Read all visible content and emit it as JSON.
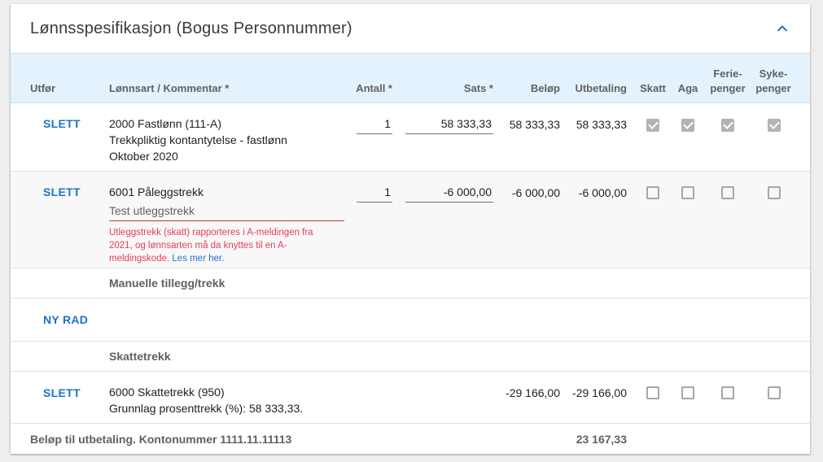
{
  "title": "Lønnsspesifikasjon (Bogus Personnummer)",
  "headers": {
    "utfor": "Utfør",
    "lonnsart": "Lønnsart / Kommentar *",
    "antall": "Antall *",
    "sats": "Sats *",
    "belop": "Beløp",
    "utbetaling": "Utbetaling",
    "skatt": "Skatt",
    "aga": "Aga",
    "ferie_line1": "Ferie-",
    "ferie_line2": "penger",
    "syke_line1": "Syke-",
    "syke_line2": "penger"
  },
  "rows": [
    {
      "action": "SLETT",
      "line1": "2000 Fastlønn (111-A)",
      "line2": "Trekkpliktig kontantytelse - fastlønn",
      "line3": "Oktober 2020",
      "antall": "1",
      "sats": "58 333,33",
      "belop": "58 333,33",
      "utbetaling": "58 333,33",
      "skatt": true,
      "aga": true,
      "ferie": true,
      "syke": true
    },
    {
      "action": "SLETT",
      "line1": "6001 Påleggstrekk",
      "comment": "Test utleggstrekk",
      "error": "Utleggstrekk (skatt) rapporteres i A-meldingen fra 2021, og lønnsarten må da knyttes til en A-meldingskode.",
      "error_link": "Les mer her.",
      "antall": "1",
      "sats": "-6 000,00",
      "belop": "-6 000,00",
      "utbetaling": "-6 000,00",
      "skatt": false,
      "aga": false,
      "ferie": false,
      "syke": false
    },
    {
      "action": "SLETT",
      "line1": "6000 Skattetrekk (950)",
      "line2": "Grunnlag prosenttrekk (%): 58 333,33.",
      "belop": "-29 166,00",
      "utbetaling": "-29 166,00",
      "skatt": false,
      "aga": false,
      "ferie": false,
      "syke": false
    }
  ],
  "sections": {
    "manual": "Manuelle tillegg/trekk",
    "new_row": "NY RAD",
    "tax": "Skattetrekk"
  },
  "footer": {
    "label": "Beløp til utbetaling. Kontonummer 1111.11.11113",
    "total": "23 167,33"
  },
  "colors": {
    "accent": "#1e73c8",
    "header_bg": "#e3f2fd",
    "error": "#e53e5c"
  }
}
